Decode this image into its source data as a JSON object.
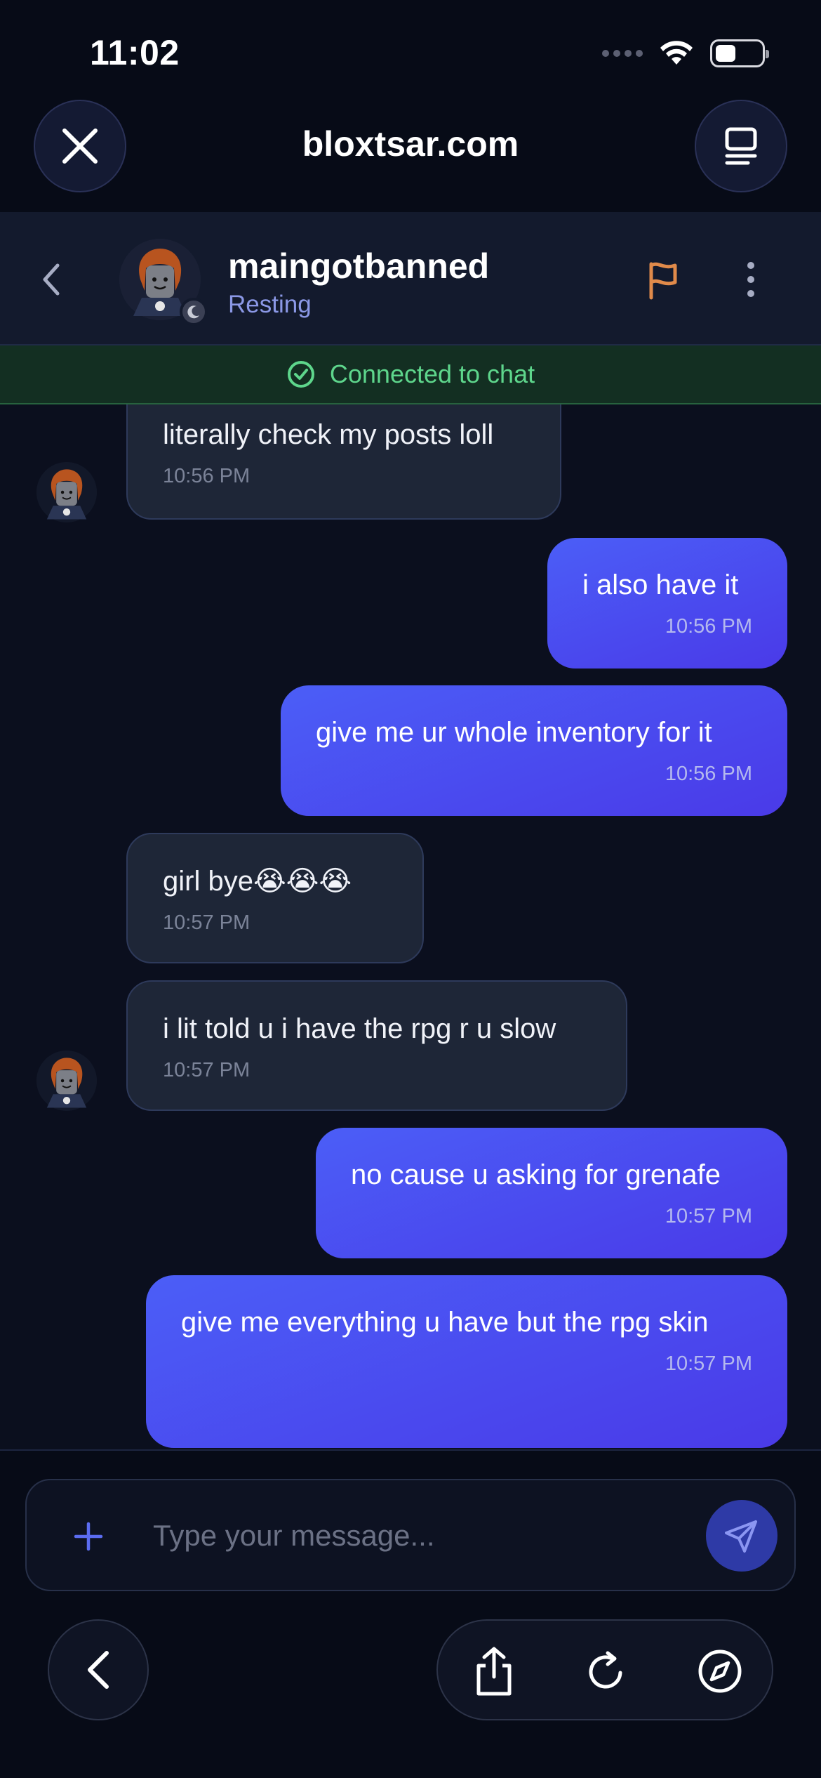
{
  "status_bar": {
    "time": "11:02"
  },
  "browser": {
    "url": "bloxtsar.com"
  },
  "chat_header": {
    "username": "maingotbanned",
    "presence": "Resting"
  },
  "banner": {
    "text": "Connected to chat"
  },
  "messages": [
    {
      "direction": "received",
      "text": "literally check my posts loll",
      "time": "10:56 PM"
    },
    {
      "direction": "sent",
      "text": "i also have it",
      "time": "10:56 PM"
    },
    {
      "direction": "sent",
      "text": "give me ur whole inventory for it",
      "time": "10:56 PM"
    },
    {
      "direction": "received",
      "text": "girl bye😭😭😭",
      "time": "10:57 PM"
    },
    {
      "direction": "received",
      "text": "i lit told u i have the rpg r u slow",
      "time": "10:57 PM"
    },
    {
      "direction": "sent",
      "text": "no cause u asking for grenafe",
      "time": "10:57 PM"
    },
    {
      "direction": "sent",
      "text": "give me everything u have but the rpg skin",
      "time": "10:57 PM"
    }
  ],
  "composer": {
    "placeholder": "Type your message..."
  },
  "colors": {
    "background": "#0b0f1e",
    "received_bubble": "#1e2637",
    "sent_bubble_start": "#4b5ef7",
    "sent_bubble_end": "#4a3ae8",
    "presence_text": "#8b98e6",
    "flag_accent": "#e08a4a",
    "connected_green": "#5ed68c"
  },
  "icons": {
    "close": "close-icon",
    "tabs": "tabs-icon",
    "back": "chevron-left-icon",
    "moon": "moon-icon",
    "flag": "flag-icon",
    "more": "more-vertical-icon",
    "check": "check-circle-icon",
    "plus": "plus-icon",
    "send": "send-icon",
    "share": "share-icon",
    "reload": "reload-icon",
    "compass": "compass-icon"
  }
}
